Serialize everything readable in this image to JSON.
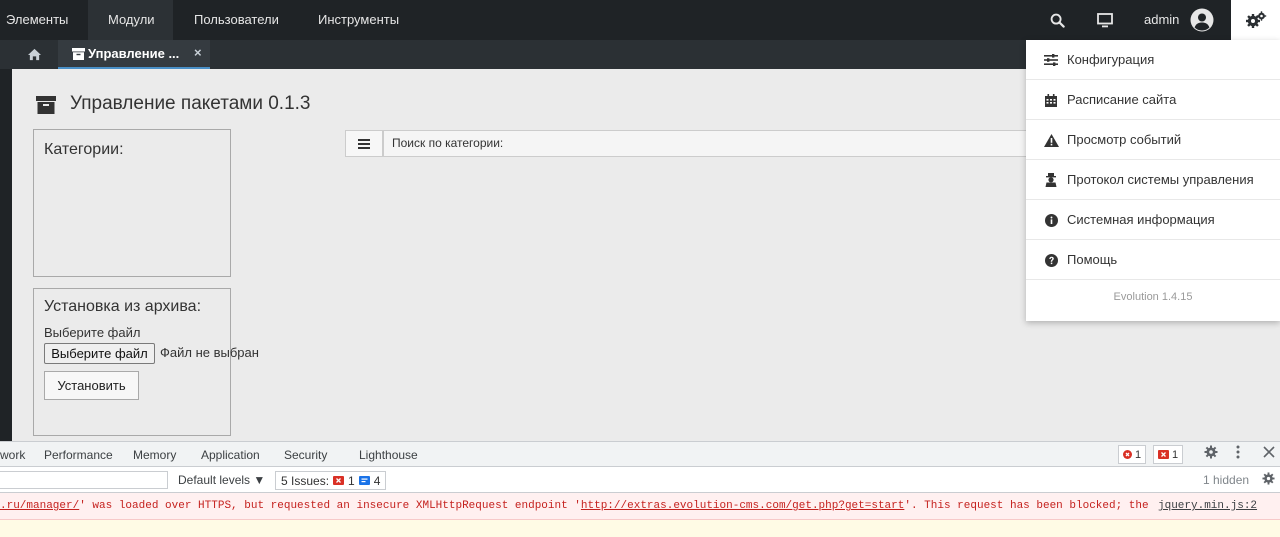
{
  "topnav": {
    "items": [
      "Элементы",
      "Модули",
      "Пользователи",
      "Инструменты"
    ],
    "active_index": 1,
    "user": "admin"
  },
  "tabs": {
    "active_label": "Управление ...",
    "close": "×"
  },
  "page": {
    "title": "Управление пакетами 0.1.3",
    "categories_title": "Категории:",
    "archive_title": "Установка из архива:",
    "file_label": "Выберите файл",
    "file_button": "Выберите файл",
    "file_none": "Файл не выбран",
    "install_button": "Установить",
    "search_text": "Поиск по категории:"
  },
  "dropdown": {
    "items": [
      {
        "label": "Конфигурация",
        "icon": "sliders-icon"
      },
      {
        "label": "Расписание сайта",
        "icon": "calendar-icon"
      },
      {
        "label": "Просмотр событий",
        "icon": "warning-icon"
      },
      {
        "label": "Протокол системы управления",
        "icon": "user-secret-icon"
      },
      {
        "label": "Системная информация",
        "icon": "info-icon"
      },
      {
        "label": "Помощь",
        "icon": "question-icon"
      }
    ],
    "version": "Evolution 1.4.15"
  },
  "devtools": {
    "tabs": [
      "work",
      "Performance",
      "Memory",
      "Application",
      "Security",
      "Lighthouse"
    ],
    "error_count": "1",
    "issue_badge_count": "1",
    "levels": "Default levels ▼",
    "issues_label": "5 Issues:",
    "issues_errors": "1",
    "issues_info": "4",
    "hidden": "1 hidden",
    "error_prefix": ".ru/manager/",
    "error_mid": "' was loaded over HTTPS, but requested an insecure XMLHttpRequest endpoint '",
    "error_url": "http://extras.evolution-cms.com/get.php?get=start",
    "error_suffix": "'. This request has been blocked; the",
    "error_source": "jquery.min.js:2"
  },
  "colors": {
    "topbar": "#1f2326",
    "accent_tab_border": "#4a90c8",
    "main_bg": "#ebebeb",
    "error_text": "#c5221f",
    "error_bg": "#fff0f0"
  }
}
